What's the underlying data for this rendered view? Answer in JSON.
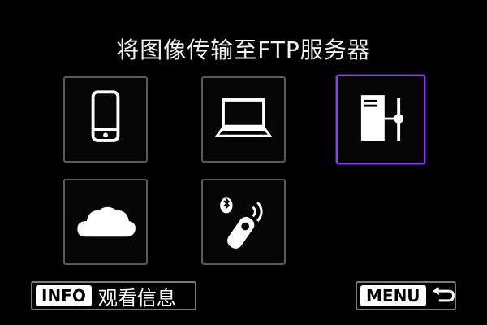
{
  "screen": {
    "title": "将图像传输至FTP服务器"
  },
  "tiles": [
    {
      "name": "smartphone",
      "icon": "smartphone-icon"
    },
    {
      "name": "computer",
      "icon": "laptop-icon"
    },
    {
      "name": "ftp-server",
      "icon": "ftp-server-icon",
      "selected": true
    },
    {
      "name": "cloud",
      "icon": "cloud-icon"
    },
    {
      "name": "bluetooth-remote",
      "icon": "bluetooth-remote-icon"
    }
  ],
  "footer": {
    "info_key": "INFO",
    "info_label": "观看信息",
    "menu_key": "MENU",
    "back_icon": "return-arrow-icon"
  },
  "colors": {
    "background": "#000000",
    "selection": "#8c3dff",
    "tile_border": "#5a5a5a"
  }
}
